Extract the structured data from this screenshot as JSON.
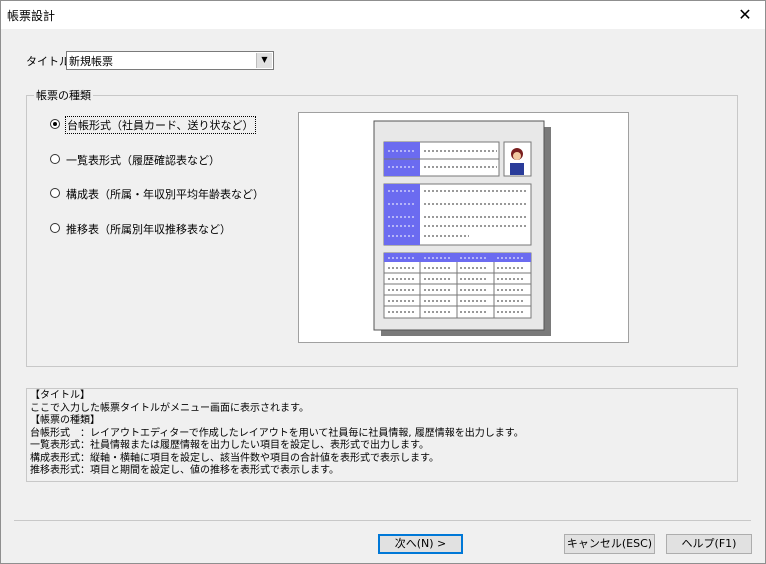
{
  "window": {
    "title": "帳票設計",
    "close_glyph": "✕"
  },
  "title_field": {
    "label": "タイトル",
    "value": "新規帳票"
  },
  "group": {
    "title": "帳票の種類",
    "options": [
      {
        "label": "台帳形式（社員カード、送り状など）",
        "selected": true
      },
      {
        "label": "一覧表形式（履歴確認表など）",
        "selected": false
      },
      {
        "label": "構成表（所属・年収別平均年齢表など）",
        "selected": false
      },
      {
        "label": "推移表（所属別年収推移表など）",
        "selected": false
      }
    ]
  },
  "description": {
    "lines": [
      "【タイトル】",
      "ここで入力した帳票タイトルがメニュー画面に表示されます。",
      "【帳票の種類】",
      "台帳形式　：レイアウトエディターで作成したレイアウトを用いて社員毎に社員情報, 履歴情報を出力します。",
      "一覧表形式：社員情報または履歴情報を出力したい項目を設定し、表形式で出力します。",
      "構成表形式：縦軸・横軸に項目を設定し、該当件数や項目の合計値を表形式で表示します。",
      "推移表形式：項目と期間を設定し、値の推移を表形式で表示します。"
    ]
  },
  "buttons": {
    "next": "次へ(N) >",
    "cancel": "キャンセル(ESC)",
    "help": "ヘルプ(F1)"
  },
  "colors": {
    "accent": "#6b6bf0",
    "window_bg": "#f0f0f0"
  }
}
